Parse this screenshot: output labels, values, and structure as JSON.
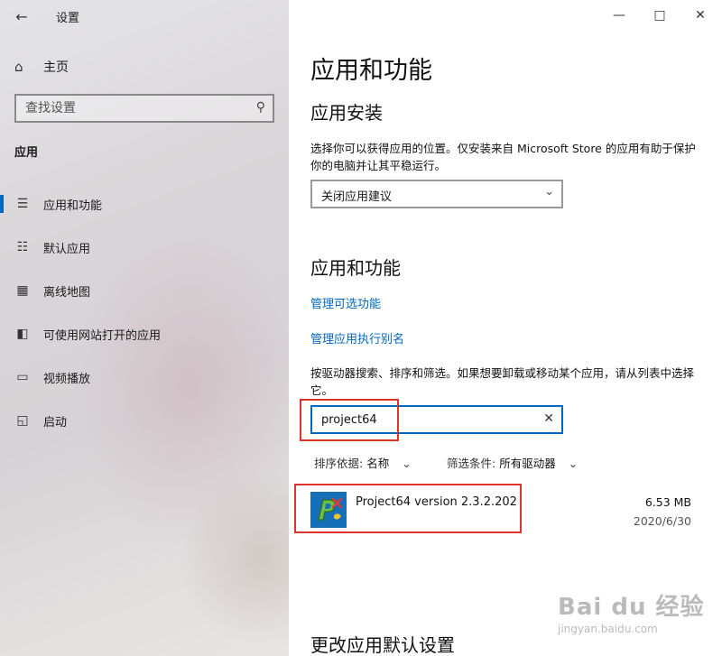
{
  "window": {
    "title": "设置",
    "back_icon": "arrow-left-icon",
    "controls": [
      "minimize",
      "maximize",
      "close"
    ]
  },
  "sidebar": {
    "home_label": "主页",
    "search_placeholder": "查找设置",
    "section_label": "应用",
    "items": [
      {
        "label": "应用和功能",
        "icon": "apps-list-icon",
        "active": true
      },
      {
        "label": "默认应用",
        "icon": "default-apps-icon",
        "active": false
      },
      {
        "label": "离线地图",
        "icon": "map-icon",
        "active": false
      },
      {
        "label": "可使用网站打开的应用",
        "icon": "open-in-window-icon",
        "active": false
      },
      {
        "label": "视频播放",
        "icon": "video-icon",
        "active": false
      },
      {
        "label": "启动",
        "icon": "startup-icon",
        "active": false
      }
    ]
  },
  "main": {
    "page_title": "应用和功能",
    "install_heading": "应用安装",
    "install_desc": "选择你可以获得应用的位置。仅安装来自 Microsoft Store 的应用有助于保护你的电脑并让其平稳运行。",
    "install_dropdown_value": "关闭应用建议",
    "apps_heading": "应用和功能",
    "link_optional": "管理可选功能",
    "link_aliases": "管理应用执行别名",
    "search_desc": "按驱动器搜索、排序和筛选。如果想要卸载或移动某个应用，请从列表中选择它。",
    "search_value": "project64",
    "sort_label": "排序依据:",
    "sort_value": "名称",
    "filter_label": "筛选条件:",
    "filter_value": "所有驱动器",
    "apps": [
      {
        "name": "Project64 version 2.3.2.202",
        "size": "6.53 MB",
        "date": "2020/6/30"
      }
    ],
    "change_defaults_heading": "更改应用默认设置"
  },
  "watermark": {
    "top": "Bai du 经验",
    "bottom": "jingyan.baidu.com"
  },
  "colors": {
    "accent": "#0067c0",
    "highlight": "#e0312a"
  }
}
